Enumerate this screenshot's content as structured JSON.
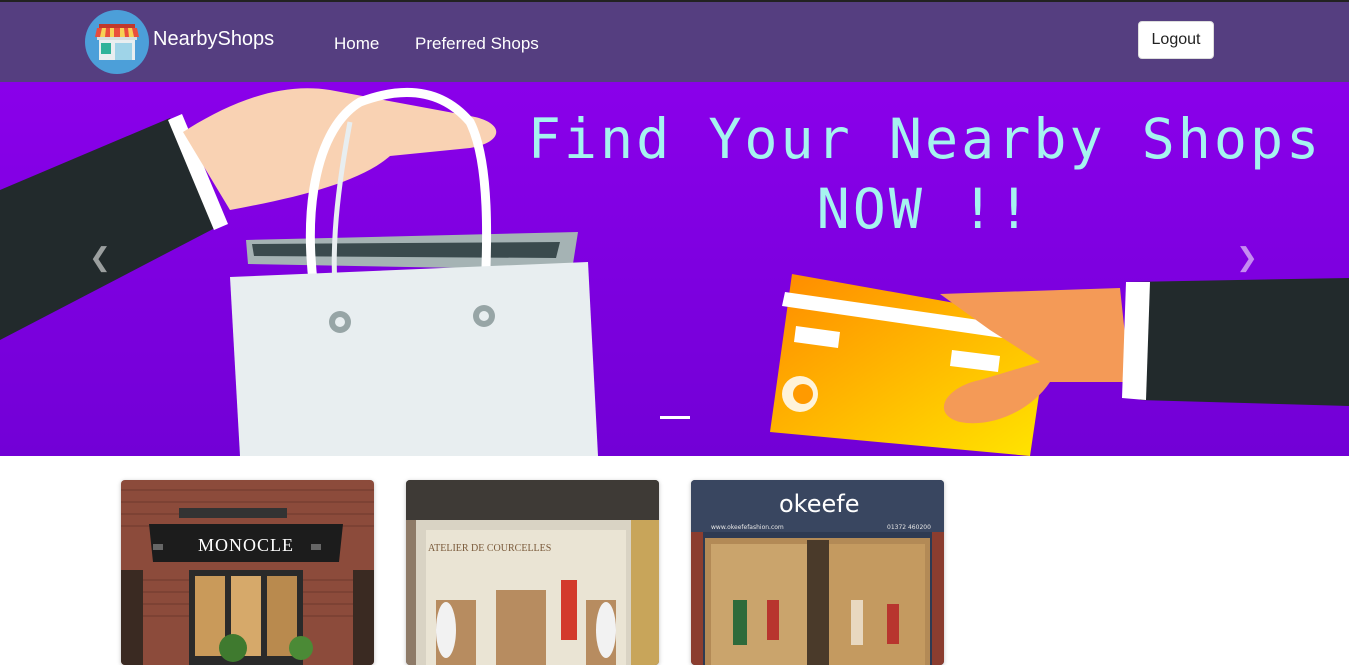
{
  "navbar": {
    "brand_name": "NearbyShops",
    "logo_icon": "shop-storefront-icon",
    "links": [
      {
        "label": "Home"
      },
      {
        "label": "Preferred Shops"
      }
    ],
    "logout_label": "Logout",
    "background_color": "#553e80"
  },
  "hero": {
    "title_line1": "Find Your Nearby Shops",
    "title_line2": "NOW !!",
    "prev_icon": "chevron-left-icon",
    "next_icon": "chevron-right-icon",
    "background_color": "#8000e0",
    "title_color": "#a6f3ef"
  },
  "shops": [
    {
      "sign": "MONOCLE"
    },
    {
      "sign": "ATELIER DE COURCELLES"
    },
    {
      "sign": "okeefe",
      "website": "www.okeefefashion.com",
      "phone": "01372 460200"
    }
  ]
}
